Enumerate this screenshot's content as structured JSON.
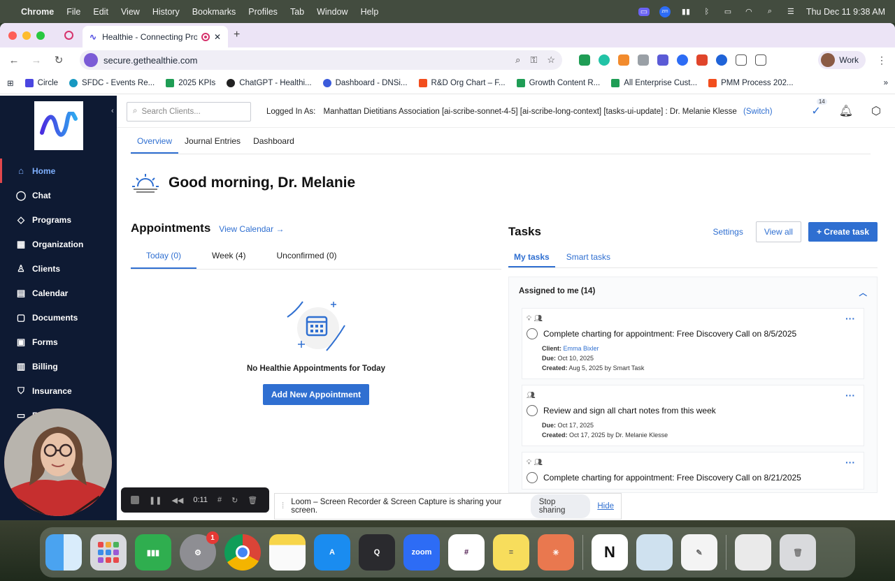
{
  "menubar": {
    "items": [
      "Chrome",
      "File",
      "Edit",
      "View",
      "History",
      "Bookmarks",
      "Profiles",
      "Tab",
      "Window",
      "Help"
    ],
    "clock": "Thu Dec 11  9:38 AM",
    "zoom_label": "zm"
  },
  "browser": {
    "tab_title": "Healthie - Connecting Pro",
    "url": "secure.gethealthie.com",
    "profile": "Work",
    "bookmarks": [
      "Circle",
      "SFDC - Events Re...",
      "2025 KPIs",
      "ChatGPT - Healthi...",
      "Dashboard - DNSi...",
      "R&D Org Chart – F...",
      "Growth Content R...",
      "All Enterprise Cust...",
      "PMM Process 202..."
    ]
  },
  "sidebar": {
    "items": [
      {
        "label": "Home",
        "icon": "home-icon"
      },
      {
        "label": "Chat",
        "icon": "chat-icon"
      },
      {
        "label": "Programs",
        "icon": "programs-icon"
      },
      {
        "label": "Organization",
        "icon": "organization-icon"
      },
      {
        "label": "Clients",
        "icon": "clients-icon"
      },
      {
        "label": "Calendar",
        "icon": "calendar-icon"
      },
      {
        "label": "Documents",
        "icon": "documents-icon"
      },
      {
        "label": "Forms",
        "icon": "forms-icon"
      },
      {
        "label": "Billing",
        "icon": "billing-icon"
      },
      {
        "label": "Insurance",
        "icon": "insurance-icon"
      },
      {
        "label": "Faxi",
        "icon": "fax-icon"
      }
    ]
  },
  "topbar": {
    "search_placeholder": "Search Clients...",
    "logged_in_label": "Logged In As:",
    "logged_in_value": "Manhattan Dietitians Association [ai-scribe-sonnet-4-5] [ai-scribe-long-context] [tasks-ui-update] : Dr. Melanie Klesse",
    "switch": "(Switch)",
    "task_count": "14"
  },
  "subtabs": [
    "Overview",
    "Journal Entries",
    "Dashboard"
  ],
  "greeting": "Good morning, Dr. Melanie",
  "appointments": {
    "title": "Appointments",
    "view_calendar": "View Calendar →",
    "tabs": [
      "Today (0)",
      "Week (4)",
      "Unconfirmed (0)"
    ],
    "empty_text": "No Healthie Appointments for Today",
    "add_button": "Add New Appointment"
  },
  "tasks": {
    "title": "Tasks",
    "settings": "Settings",
    "view_all": "View all",
    "create": "+ Create task",
    "tabs": [
      "My tasks",
      "Smart tasks"
    ],
    "assigned_header": "Assigned to me (14)",
    "items": [
      {
        "title": "Complete charting for appointment: Free Discovery Call on 8/5/2025",
        "client_label": "Client:",
        "client": "Emma Bixler",
        "due_label": "Due:",
        "due": "Oct 10, 2025",
        "created_label": "Created:",
        "created": "Aug 5, 2025 by Smart Task"
      },
      {
        "title": "Review and sign all chart notes from this week",
        "due_label": "Due:",
        "due": "Oct 17, 2025",
        "created_label": "Created:",
        "created": "Oct 17, 2025 by Dr. Melanie Klesse"
      },
      {
        "title": "Complete charting for appointment: Free Discovery Call on 8/21/2025"
      }
    ]
  },
  "loom": {
    "timer": "0:11",
    "share_text": "Loom – Screen Recorder & Screen Capture is sharing your screen.",
    "stop_sharing": "Stop sharing",
    "hide": "Hide"
  },
  "dock": {
    "apps": [
      "finder",
      "launchpad",
      "numbers",
      "system-settings",
      "chrome",
      "notes",
      "app-store",
      "quicktime",
      "zoom",
      "slack",
      "stickies",
      "claude",
      "notion",
      "preview",
      "textedit",
      "documents",
      "trash"
    ],
    "settings_badge": "1",
    "zoom_label": "zoom"
  }
}
